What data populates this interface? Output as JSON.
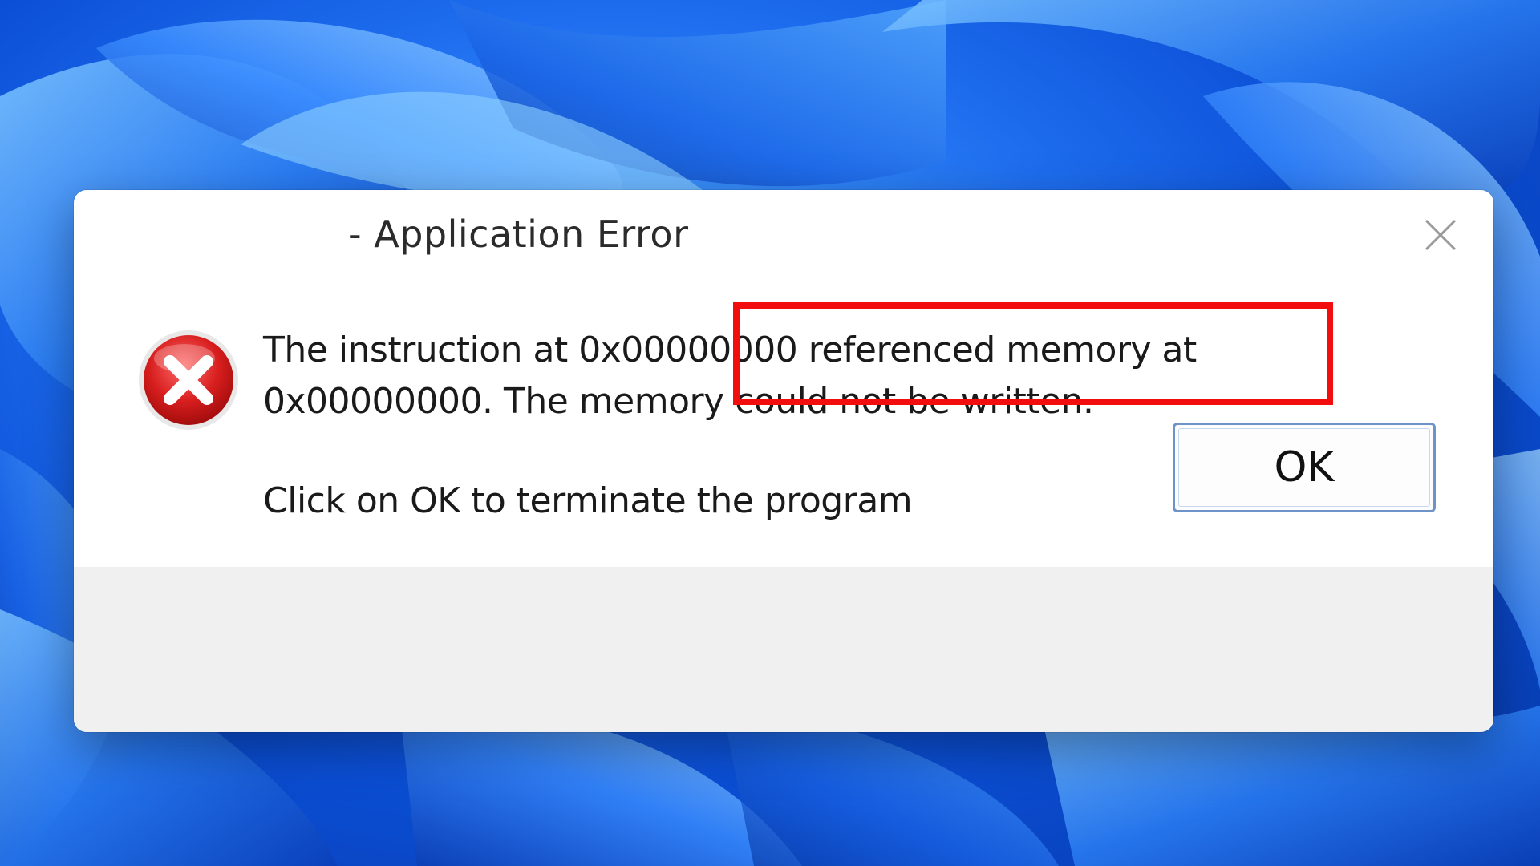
{
  "dialog": {
    "title": "- Application Error",
    "message_line1": "The instruction at 0x00000000 referenced memory at 0x00000000. The memory could not be written.",
    "message_line2": "Click on OK to terminate the program",
    "ok_label": "OK"
  },
  "icons": {
    "error": "error-icon",
    "close": "close-icon"
  },
  "colors": {
    "highlight": "#f20e0e",
    "error_red": "#d81e1e",
    "wallpaper_blue": "#1f6ff0"
  }
}
